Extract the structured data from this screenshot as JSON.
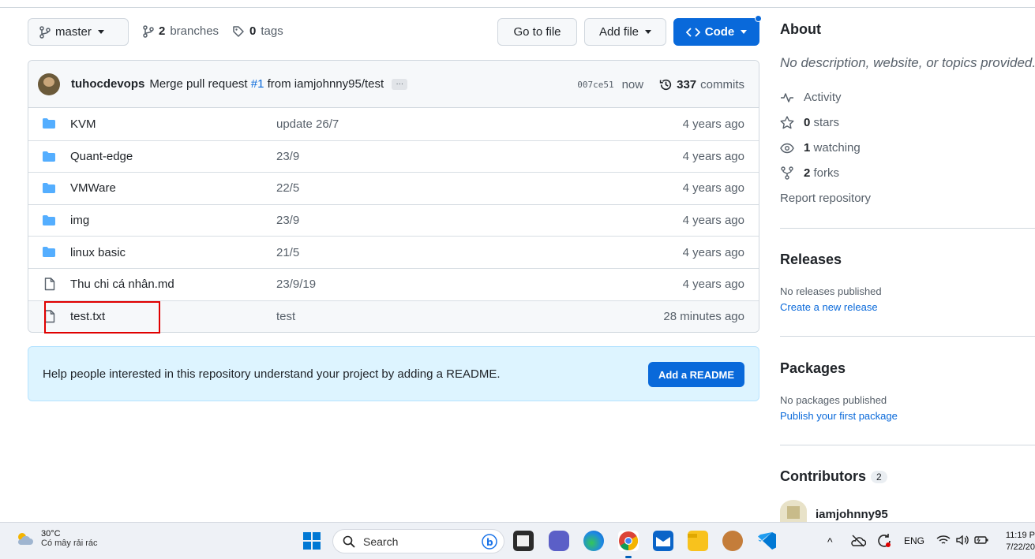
{
  "toolbar": {
    "branch": "master",
    "branches_count": "2",
    "branches_label": "branches",
    "tags_count": "0",
    "tags_label": "tags",
    "go_to_file": "Go to file",
    "add_file": "Add file",
    "code": "Code"
  },
  "commit": {
    "author": "tuhocdevops",
    "message_pre": "Merge pull request ",
    "pr": "#1",
    "message_post": " from iamjohnny95/test",
    "ellipsis": "…",
    "sha": "007ce51",
    "when": "now",
    "commits_count": "337",
    "commits_label": "commits"
  },
  "files": [
    {
      "type": "dir",
      "name": "KVM",
      "message": "update 26/7",
      "age": "4 years ago"
    },
    {
      "type": "dir",
      "name": "Quant-edge",
      "message": "23/9",
      "age": "4 years ago"
    },
    {
      "type": "dir",
      "name": "VMWare",
      "message": "22/5",
      "age": "4 years ago"
    },
    {
      "type": "dir",
      "name": "img",
      "message": "23/9",
      "age": "4 years ago"
    },
    {
      "type": "dir",
      "name": "linux basic",
      "message": "21/5",
      "age": "4 years ago"
    },
    {
      "type": "file",
      "name": "Thu chi cá nhân.md",
      "message": "23/9/19",
      "age": "4 years ago"
    },
    {
      "type": "file",
      "name": "test.txt",
      "message": "test",
      "age": "28 minutes ago"
    }
  ],
  "readme": {
    "text": "Help people interested in this repository understand your project by adding a README.",
    "button": "Add a README"
  },
  "sidebar": {
    "about_title": "About",
    "about_desc": "No description, website, or topics provided.",
    "activity": "Activity",
    "stars_count": "0",
    "stars_label": "stars",
    "watching_count": "1",
    "watching_label": "watching",
    "forks_count": "2",
    "forks_label": "forks",
    "report": "Report repository",
    "releases_title": "Releases",
    "releases_none": "No releases published",
    "releases_link": "Create a new release",
    "packages_title": "Packages",
    "packages_none": "No packages published",
    "packages_link": "Publish your first package",
    "contributors_title": "Contributors",
    "contributors_count": "2",
    "contributor_name": "iamjohnny95"
  },
  "taskbar": {
    "temp": "30°C",
    "weather": "Có mây rải rác",
    "search": "Search",
    "lang": "ENG",
    "time": "11:19 P",
    "date": "7/22/20"
  },
  "colors": {
    "accent": "#0969da",
    "highlight_box": "#e00000",
    "folder": "#54aeff"
  }
}
